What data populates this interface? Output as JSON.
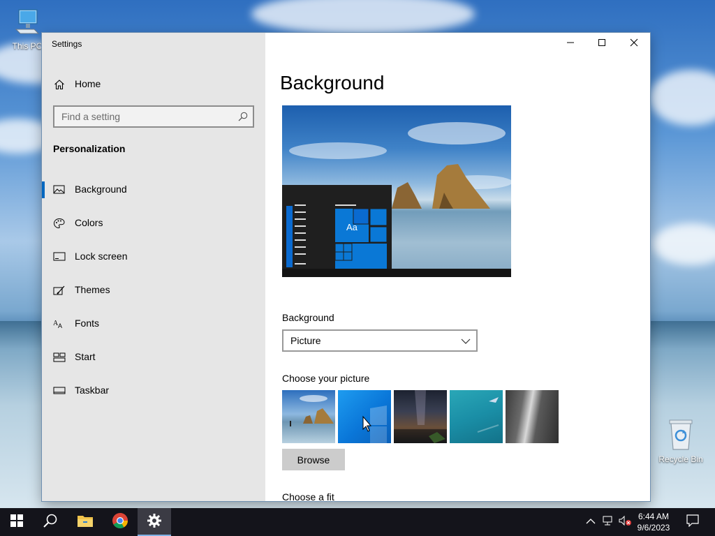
{
  "desktop": {
    "icons": [
      {
        "label": "This PC"
      },
      {
        "label": "Recycle Bin"
      }
    ]
  },
  "window": {
    "title": "Settings",
    "controls": {
      "minimize": "minimize-icon",
      "maximize": "maximize-icon",
      "close": "close-icon"
    }
  },
  "sidebar": {
    "home_label": "Home",
    "search_placeholder": "Find a setting",
    "section_title": "Personalization",
    "items": [
      {
        "label": "Background",
        "icon": "image-icon",
        "active": true
      },
      {
        "label": "Colors",
        "icon": "palette-icon",
        "active": false
      },
      {
        "label": "Lock screen",
        "icon": "lock-screen-icon",
        "active": false
      },
      {
        "label": "Themes",
        "icon": "themes-icon",
        "active": false
      },
      {
        "label": "Fonts",
        "icon": "fonts-icon",
        "active": false
      },
      {
        "label": "Start",
        "icon": "start-icon",
        "active": false
      },
      {
        "label": "Taskbar",
        "icon": "taskbar-icon",
        "active": false
      }
    ]
  },
  "main": {
    "title": "Background",
    "preview_tile_text": "Aa",
    "background_label": "Background",
    "background_value": "Picture",
    "choose_picture_label": "Choose your picture",
    "browse_label": "Browse",
    "choose_fit_label": "Choose a fit"
  },
  "taskbar": {
    "time": "6:44 AM",
    "date": "9/6/2023"
  },
  "colors": {
    "accent": "#0067c0",
    "sidebar_bg": "#e6e6e6",
    "taskbar_bg": "#14141b"
  }
}
